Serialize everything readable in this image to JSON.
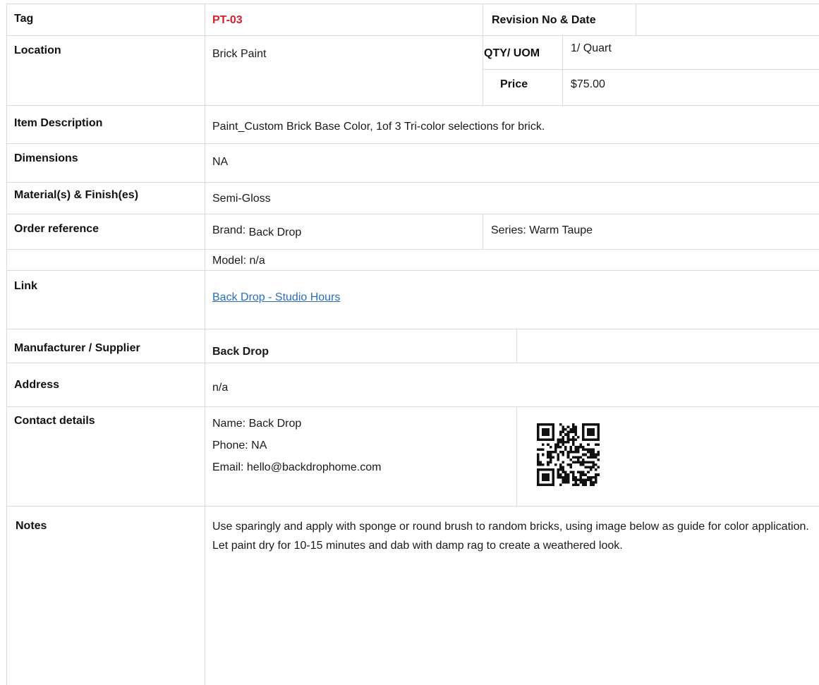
{
  "tag": {
    "label": "Tag",
    "value": "PT-03"
  },
  "revision": {
    "label": "Revision No & Date",
    "value": ""
  },
  "location": {
    "label": "Location",
    "value": "Brick Paint"
  },
  "qty_uom": {
    "label": "QTY/ UOM",
    "value": "1/ Quart"
  },
  "price": {
    "label": "Price",
    "value": "$75.00"
  },
  "item_description": {
    "label": "Item Description",
    "value": "Paint_Custom Brick Base Color, 1of 3 Tri-color selections for brick."
  },
  "dimensions": {
    "label": "Dimensions",
    "value": "NA"
  },
  "materials": {
    "label": "Material(s) & Finish(es)",
    "value": "Semi-Gloss"
  },
  "order_reference": {
    "label": "Order reference",
    "brand_prefix": "Brand:",
    "brand": "Back Drop",
    "series": "Series: Warm Taupe",
    "model": "Model: n/a"
  },
  "link": {
    "label": "Link",
    "text": "Back Drop - Studio Hours"
  },
  "manufacturer": {
    "label": "Manufacturer / Supplier",
    "value": "Back Drop"
  },
  "address": {
    "label": "Address",
    "value": "n/a"
  },
  "contact": {
    "label": "Contact details",
    "name": "Name:  Back Drop",
    "phone": "Phone: NA",
    "email": "Email:  hello@backdrophome.com",
    "qr_icon": "qr-code-icon"
  },
  "notes": {
    "label": "Notes",
    "text": "Use sparingly and apply with sponge or round brush to random bricks, using image below as guide for color application. Let paint dry for 10-15 minutes and dab with damp rag to create a weathered look."
  },
  "colors": {
    "tag_code": "#d2232a",
    "link": "#2a6ebb",
    "grid_line": "#dcdcdc"
  }
}
